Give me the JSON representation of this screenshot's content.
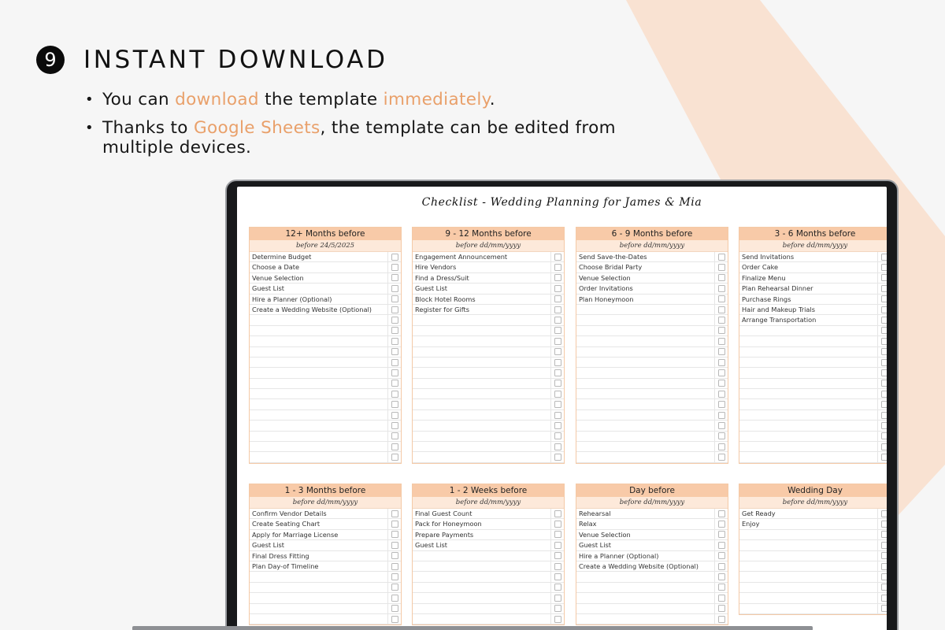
{
  "heading": {
    "number": "9",
    "title": "INSTANT DOWNLOAD"
  },
  "bullets": [
    {
      "parts": [
        {
          "text": "You can ",
          "hl": false
        },
        {
          "text": "download",
          "hl": true
        },
        {
          "text": " the template ",
          "hl": false
        },
        {
          "text": "immediately",
          "hl": true
        },
        {
          "text": ".",
          "hl": false
        }
      ]
    },
    {
      "parts": [
        {
          "text": "Thanks to ",
          "hl": false
        },
        {
          "text": "Google Sheets",
          "hl": true
        },
        {
          "text": ", the template can be edited from multiple devices.",
          "hl": false
        }
      ]
    }
  ],
  "colors": {
    "accent": "#e9a06a",
    "stripe": "#f9e2d2",
    "card_header": "#f8caa8",
    "card_sub": "#fde9da"
  },
  "sheet": {
    "title": "Checklist - Wedding Planning for James & Mia",
    "cards": [
      {
        "title": "12+ Months before",
        "subtitle": "before 24/5/2025",
        "rows": 20,
        "items": [
          "Determine Budget",
          "Choose a Date",
          "Venue Selection",
          "Guest List",
          "Hire a Planner (Optional)",
          "Create a Wedding Website (Optional)"
        ]
      },
      {
        "title": "9 - 12 Months before",
        "subtitle": "before dd/mm/yyyy",
        "rows": 20,
        "items": [
          "Engagement Announcement",
          "Hire Vendors",
          "Find a Dress/Suit",
          "Guest List",
          "Block Hotel Rooms",
          "Register for Gifts"
        ]
      },
      {
        "title": "6 - 9 Months before",
        "subtitle": "before dd/mm/yyyy",
        "rows": 20,
        "items": [
          "Send Save-the-Dates",
          "Choose Bridal Party",
          "Venue Selection",
          "Order Invitations",
          "Plan Honeymoon"
        ]
      },
      {
        "title": "3 - 6 Months before",
        "subtitle": "before dd/mm/yyyy",
        "rows": 20,
        "items": [
          "Send Invitations",
          "Order Cake",
          "Finalize Menu",
          "Plan Rehearsal Dinner",
          "Purchase Rings",
          "Hair and Makeup Trials",
          "Arrange Transportation"
        ]
      },
      {
        "title": "1 - 3 Months before",
        "subtitle": "before dd/mm/yyyy",
        "rows": 11,
        "items": [
          "Confirm Vendor Details",
          "Create Seating Chart",
          "Apply for Marriage License",
          "Guest List",
          "Final Dress Fitting",
          "Plan Day-of Timeline"
        ]
      },
      {
        "title": "1 - 2 Weeks before",
        "subtitle": "before dd/mm/yyyy",
        "rows": 11,
        "items": [
          "Final Guest Count",
          "Pack for Honeymoon",
          "Prepare Payments",
          "Guest List"
        ]
      },
      {
        "title": "Day before",
        "subtitle": "before dd/mm/yyyy",
        "rows": 11,
        "items": [
          "Rehearsal",
          "Relax",
          "Venue Selection",
          "Guest List",
          "Hire a Planner (Optional)",
          "Create a Wedding Website (Optional)"
        ]
      },
      {
        "title": "Wedding Day",
        "subtitle": "before dd/mm/yyyy",
        "rows": 10,
        "items": [
          "Get Ready",
          "Enjoy"
        ]
      }
    ]
  }
}
